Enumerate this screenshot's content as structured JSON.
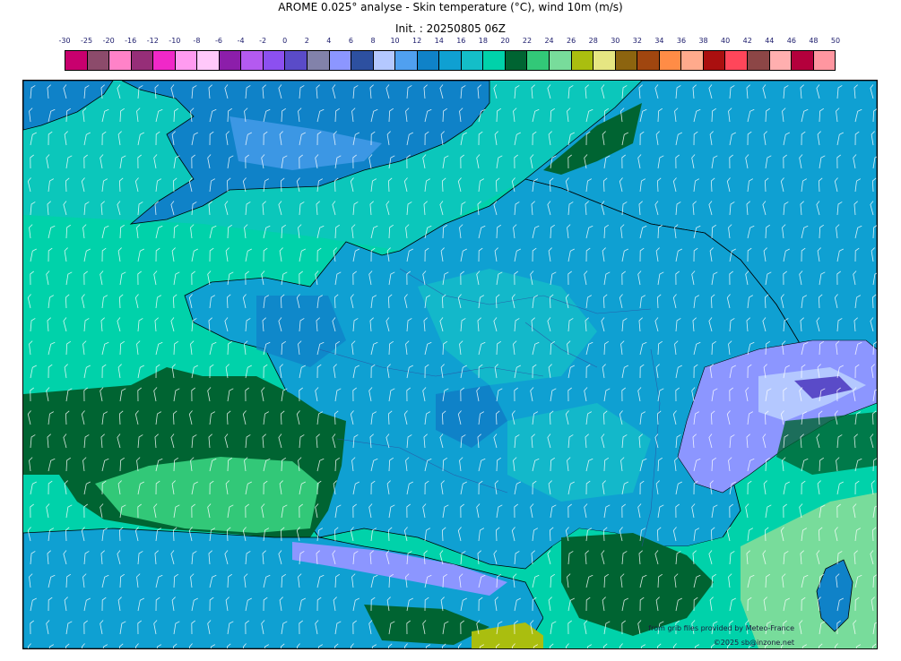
{
  "header": {
    "title": "AROME 0.025° analyse - Skin temperature (°C), wind 10m (m/s)",
    "init": "Init. : 20250805 06Z"
  },
  "colorbar": {
    "ticks": [
      "-30",
      "-25",
      "-20",
      "-16",
      "-12",
      "-10",
      "-8",
      "-6",
      "-4",
      "-2",
      "0",
      "2",
      "4",
      "6",
      "8",
      "10",
      "12",
      "14",
      "16",
      "18",
      "20",
      "22",
      "24",
      "26",
      "28",
      "30",
      "32",
      "34",
      "36",
      "38",
      "40",
      "42",
      "44",
      "46",
      "48",
      "50"
    ],
    "colors": [
      "#c8006e",
      "#8c4b6b",
      "#ff82c8",
      "#962e78",
      "#f028c8",
      "#ff9bf0",
      "#ffc8fa",
      "#8c1eaa",
      "#b45af0",
      "#8c50f0",
      "#5a4bc8",
      "#8282aa",
      "#8c96ff",
      "#2d50a0",
      "#b4c8ff",
      "#50a0f0",
      "#0f82c8",
      "#0fa0d2",
      "#14bec8",
      "#00d2aa",
      "#006432",
      "#32c878",
      "#78dc9b",
      "#aabe0f",
      "#e6e682",
      "#8c640f",
      "#a0460f",
      "#ff8c46",
      "#ffaa8c",
      "#aa0f0f",
      "#ff465a",
      "#8c4646",
      "#ffafaf",
      "#b4003c",
      "#ff96a0"
    ]
  },
  "map": {
    "features": [
      "sea-warm",
      "sea-mild",
      "land",
      "mountains",
      "coastline",
      "borders",
      "rivers",
      "wind-barbs"
    ]
  },
  "credits": {
    "source": "from grib files provided by Meteo-France",
    "copyright": "©2025 sb@inzone.net"
  }
}
